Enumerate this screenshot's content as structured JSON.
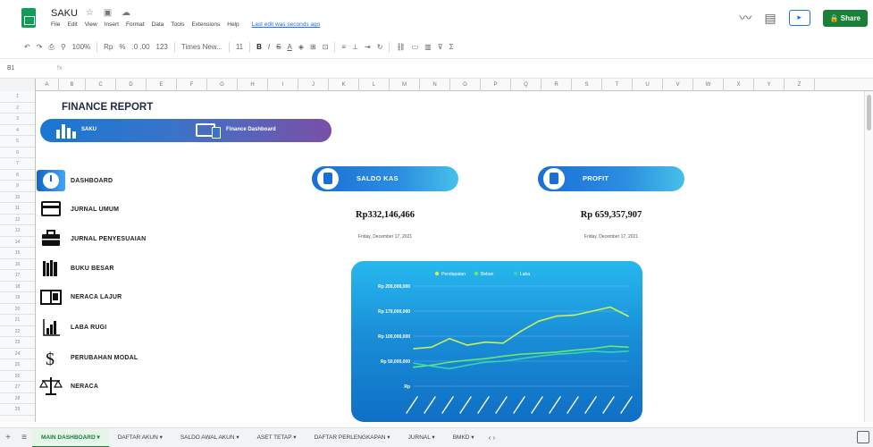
{
  "header": {
    "doc_title": "SAKU",
    "title_icons": "☆ ▣ ☁",
    "menu": [
      "File",
      "Edit",
      "View",
      "Insert",
      "Format",
      "Data",
      "Tools",
      "Extensions",
      "Help"
    ],
    "last_edit": "Last edit was seconds ago",
    "share_label": "Share"
  },
  "toolbar": {
    "zoom": "100%",
    "currency": "Rp",
    "percent": "%",
    "decimals": ".0  .00",
    "number_format": "123",
    "font": "Times New...",
    "font_size": "11"
  },
  "formula_bar": {
    "name_box": "B1",
    "fx": "fx"
  },
  "columns": [
    "A",
    "B",
    "C",
    "D",
    "E",
    "F",
    "G",
    "H",
    "I",
    "J",
    "K",
    "L",
    "M",
    "N",
    "O",
    "P",
    "Q",
    "R",
    "S",
    "T",
    "U",
    "V",
    "W",
    "X",
    "Y",
    "Z"
  ],
  "rows": [
    "1",
    "2",
    "3",
    "4",
    "5",
    "6",
    "7",
    "8",
    "9",
    "10",
    "11",
    "12",
    "13",
    "14",
    "15",
    "16",
    "17",
    "18",
    "19",
    "20",
    "21",
    "22",
    "23",
    "24",
    "25",
    "26",
    "27",
    "28",
    "29"
  ],
  "report": {
    "title": "FINANCE REPORT",
    "banner_left": "SAKU",
    "banner_right": "Finance Dashboard"
  },
  "menu_items": [
    {
      "label": "DASHBOARD",
      "icon": "clock-icon",
      "active": true
    },
    {
      "label": "JURNAL UMUM",
      "icon": "credit-card-icon",
      "active": false
    },
    {
      "label": "JURNAL PENYESUAIAN",
      "icon": "briefcase-icon",
      "active": false
    },
    {
      "label": "BUKU BESAR",
      "icon": "books-icon",
      "active": false
    },
    {
      "label": "NERACA LAJUR",
      "icon": "book-open-icon",
      "active": false
    },
    {
      "label": "LABA RUGI",
      "icon": "bar-chart-icon",
      "active": false
    },
    {
      "label": "PERUBAHAN MODAL",
      "icon": "dollar-icon",
      "active": false
    },
    {
      "label": "NERACA",
      "icon": "scale-icon",
      "active": false
    }
  ],
  "kpi": {
    "saldo_label": "SALDO KAS",
    "saldo_value": "Rp332,146,466",
    "saldo_date": "Friday, December 17, 2021",
    "profit_label": "PROFIT",
    "profit_value": "Rp 659,357,907",
    "profit_date": "Friday, December 17, 2021"
  },
  "tabs": [
    "MAIN DASHBOARD ▾",
    "DAFTAR AKUN ▾",
    "SALDO AWAL AKUN ▾",
    "ASET TETAP ▾",
    "DAFTAR PERLENGKAPAN ▾",
    "JURNAL ▾",
    "BMKD ▾"
  ],
  "colors": {
    "accent": "#1a73e8",
    "share": "#188038",
    "chart_bg": "#1a8fd8"
  },
  "chart_data": {
    "type": "line",
    "legend": [
      "Pendapatan",
      "Beban",
      "Laba"
    ],
    "y_ticks": [
      "Rp 200,000,000",
      "Rp 170,000,000",
      "Rp 100,000,000",
      "Rp 50,000,000",
      "Rp"
    ],
    "ylim": [
      0,
      200000000
    ],
    "x": [
      1,
      2,
      3,
      4,
      5,
      6,
      7,
      8,
      9,
      10,
      11,
      12,
      13
    ],
    "series": [
      {
        "name": "Pendapatan",
        "values": [
          75000000,
          78000000,
          95000000,
          82000000,
          88000000,
          86000000,
          110000000,
          130000000,
          140000000,
          142000000,
          150000000,
          158000000,
          140000000
        ]
      },
      {
        "name": "Beban",
        "values": [
          38000000,
          42000000,
          48000000,
          52000000,
          55000000,
          60000000,
          64000000,
          66000000,
          68000000,
          72000000,
          75000000,
          80000000,
          78000000
        ]
      },
      {
        "name": "Laba",
        "values": [
          46000000,
          40000000,
          35000000,
          42000000,
          48000000,
          50000000,
          55000000,
          60000000,
          64000000,
          66000000,
          70000000,
          68000000,
          70000000
        ]
      }
    ]
  }
}
